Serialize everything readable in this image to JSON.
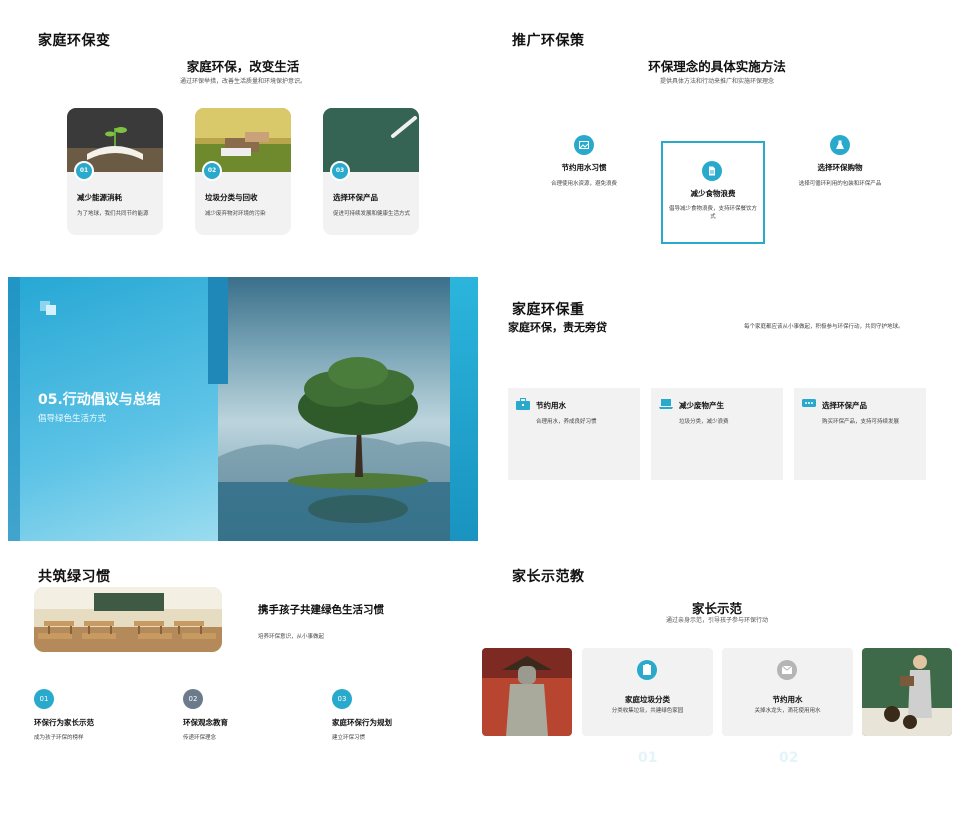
{
  "colors": {
    "accent": "#29a9cc",
    "accent_dark": "#1f88b8",
    "card_bg": "#f2f2f2",
    "gray_icon": "#6b7b8c"
  },
  "slide1": {
    "title": "家庭环保变",
    "center_title": "家庭环保，改变生活",
    "center_sub": "通过环保举措，改善生活质量和环境保护意识。",
    "cards": [
      {
        "num": "01",
        "title": "减少能源消耗",
        "desc": "为了地球，我们共同节约能源"
      },
      {
        "num": "02",
        "title": "垃圾分类与回收",
        "desc": "减少废弃物对环境的污染"
      },
      {
        "num": "03",
        "title": "选择环保产品",
        "desc": "促进可持续发展和健康生活方式"
      }
    ]
  },
  "slide2": {
    "title": "推广环保策",
    "center_title": "环保理念的具体实施方法",
    "center_sub": "提供具体方法和行动来推广和实施环保理念",
    "items": [
      {
        "icon": "image-icon",
        "title": "节约用水习惯",
        "desc": "合理使用水资源，避免浪费"
      },
      {
        "icon": "document-icon",
        "title": "减少食物浪费",
        "desc": "倡导减少食物浪费，支持环保餐饮方式"
      },
      {
        "icon": "flask-icon",
        "title": "选择环保购物",
        "desc": "选择可循环利用的包装和环保产品"
      }
    ]
  },
  "slide3": {
    "heading": "05.行动倡议与总结",
    "sub": "倡导绿色生活方式"
  },
  "slide4": {
    "title": "家庭环保重",
    "subtitle": "家庭环保，责无旁贷",
    "right_text": "每个家庭都应该从小事做起，积极参与环保行动，共同守护地球。",
    "cards": [
      {
        "icon": "toolbox-icon",
        "title": "节约用水",
        "desc": "合理用水，养成良好习惯"
      },
      {
        "icon": "laptop-icon",
        "title": "减少废物产生",
        "desc": "垃圾分类，减少浪费"
      },
      {
        "icon": "chat-icon",
        "title": "选择环保产品",
        "desc": "购买环保产品，支持可持续发展"
      }
    ]
  },
  "slide5": {
    "title": "共筑绿习惯",
    "big_title": "携手孩子共建绿色生活习惯",
    "small_text": "培养环保意识，从小事做起",
    "steps": [
      {
        "num": "01",
        "title": "环保行为家长示范",
        "desc": "成为孩子环保的榜样",
        "color": "#29a9cc"
      },
      {
        "num": "02",
        "title": "环保观念教育",
        "desc": "传递环保理念",
        "color": "#6b7b8c"
      },
      {
        "num": "03",
        "title": "家庭环保行为规划",
        "desc": "建立环保习惯",
        "color": "#29a9cc"
      }
    ]
  },
  "slide6": {
    "title": "家长示范教",
    "center_title": "家长示范",
    "center_sub": "通过亲身示范，引导孩子参与环保行动",
    "cards": [
      {
        "icon": "clipboard-icon",
        "title": "家庭垃圾分类",
        "desc": "分类收集垃圾，共建绿色家园",
        "color": "#29a9cc"
      },
      {
        "icon": "mail-icon",
        "title": "节约用水",
        "desc": "关掉水龙头，滴花使用用水",
        "color": "#b5b5b5"
      }
    ],
    "ghost_nums": [
      "01",
      "02"
    ]
  }
}
